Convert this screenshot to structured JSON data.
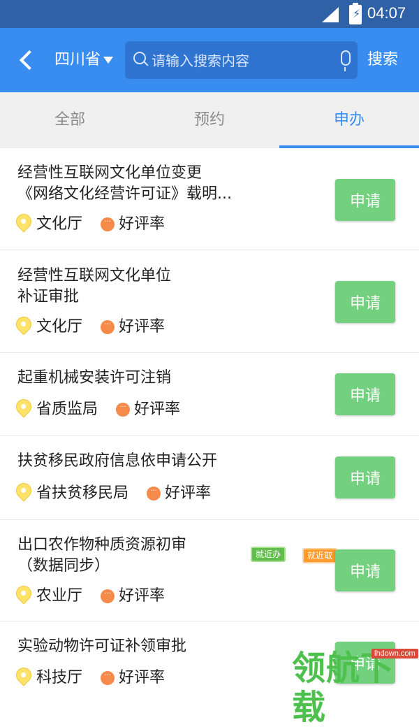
{
  "status_bar": {
    "time": "04:07",
    "battery_glyph": "⚡"
  },
  "header": {
    "province": "四川省",
    "search_placeholder": "请输入搜索内容",
    "search_button": "搜索"
  },
  "tabs": [
    {
      "label": "全部",
      "active": false
    },
    {
      "label": "预约",
      "active": false
    },
    {
      "label": "申办",
      "active": true
    }
  ],
  "list": [
    {
      "title": "经营性互联网文化单位变更\n《网络文化经营许可证》载明...",
      "dept": "文化厅",
      "rating_label": "好评率",
      "apply": "申请"
    },
    {
      "title": "经营性互联网文化单位\n补证审批",
      "dept": "文化厅",
      "rating_label": "好评率",
      "apply": "申请"
    },
    {
      "title": "起重机械安装许可注销",
      "dept": "省质监局",
      "rating_label": "好评率",
      "apply": "申请"
    },
    {
      "title": "扶贫移民政府信息依申请公开",
      "dept": "省扶贫移民局",
      "rating_label": "好评率",
      "apply": "申请"
    },
    {
      "title": "出口农作物种质资源初审\n（数据同步）",
      "dept": "农业厅",
      "rating_label": "好评率",
      "apply": "申请",
      "badges": [
        "就近办",
        "就近取"
      ]
    },
    {
      "title": "实验动物许可证补领审批",
      "dept": "科技厅",
      "rating_label": "好评率",
      "apply": "申请"
    }
  ],
  "watermark": {
    "text": "领航下载",
    "url": "lhdown.com"
  },
  "colors": {
    "primary": "#3a8df0",
    "status_bar": "#2f61a6",
    "apply_button": "#72d07e",
    "rating_icon": "#f58a4b",
    "pin_icon": "#ffe26a"
  }
}
